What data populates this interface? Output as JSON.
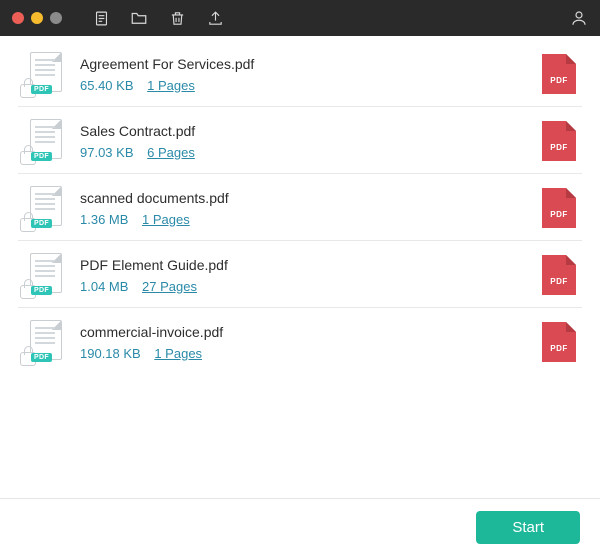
{
  "toolbar": {
    "icons": {
      "doc": "document-icon",
      "folder": "folder-icon",
      "trash": "trash-icon",
      "upload": "upload-icon",
      "user": "user-icon"
    }
  },
  "pdf_badge": "PDF",
  "output_badge": "PDF",
  "files": [
    {
      "name": "Agreement For Services.pdf",
      "size": "65.40 KB",
      "pages": "1 Pages"
    },
    {
      "name": "Sales Contract.pdf",
      "size": "97.03 KB",
      "pages": "6 Pages"
    },
    {
      "name": "scanned documents.pdf",
      "size": "1.36 MB",
      "pages": "1 Pages"
    },
    {
      "name": "PDF Element Guide.pdf",
      "size": "1.04 MB",
      "pages": "27 Pages"
    },
    {
      "name": "commercial-invoice.pdf",
      "size": "190.18 KB",
      "pages": "1 Pages"
    }
  ],
  "footer": {
    "start_label": "Start"
  }
}
